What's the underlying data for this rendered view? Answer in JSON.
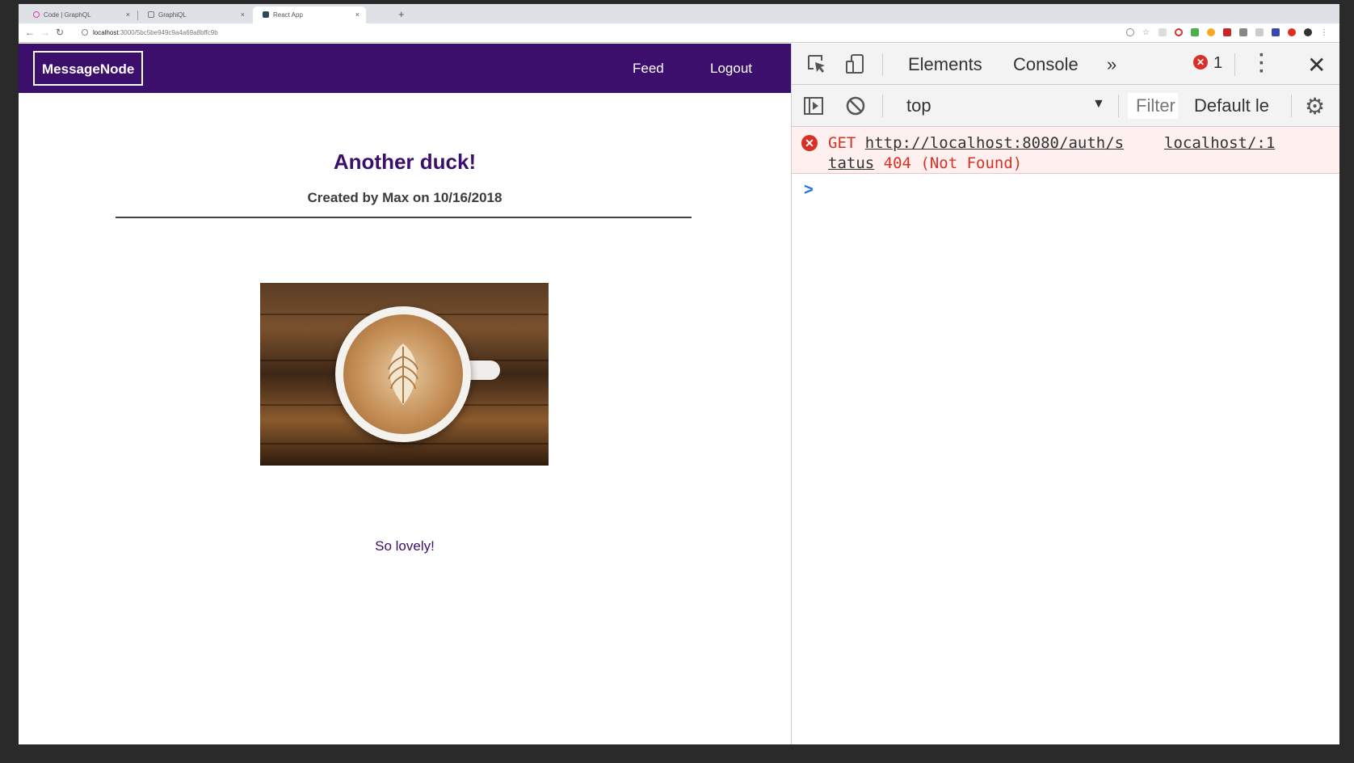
{
  "browser": {
    "tabs": [
      {
        "label": "Code | GraphQL",
        "active": false
      },
      {
        "label": "GraphiQL",
        "active": false
      },
      {
        "label": "React App",
        "active": true
      }
    ],
    "url_host": "localhost",
    "url_rest": ":3000/5bc5be949c9a4a69a8bffc9b"
  },
  "app": {
    "logo": "MessageNode",
    "nav": {
      "feed": "Feed",
      "logout": "Logout"
    },
    "post": {
      "title": "Another duck!",
      "meta": "Created by Max on 10/16/2018",
      "content": "So lovely!"
    }
  },
  "devtools": {
    "tabs": {
      "elements": "Elements",
      "console": "Console",
      "more": "»"
    },
    "error_count": "1",
    "context": "top",
    "filter_placeholder": "Filter",
    "levels": "Default le",
    "console_error": {
      "method": "GET",
      "url_part1": "http://localhost:8080/auth/s",
      "url_part2": "tatus",
      "status": "404 (Not Found)",
      "source": "localhost/:1"
    }
  }
}
